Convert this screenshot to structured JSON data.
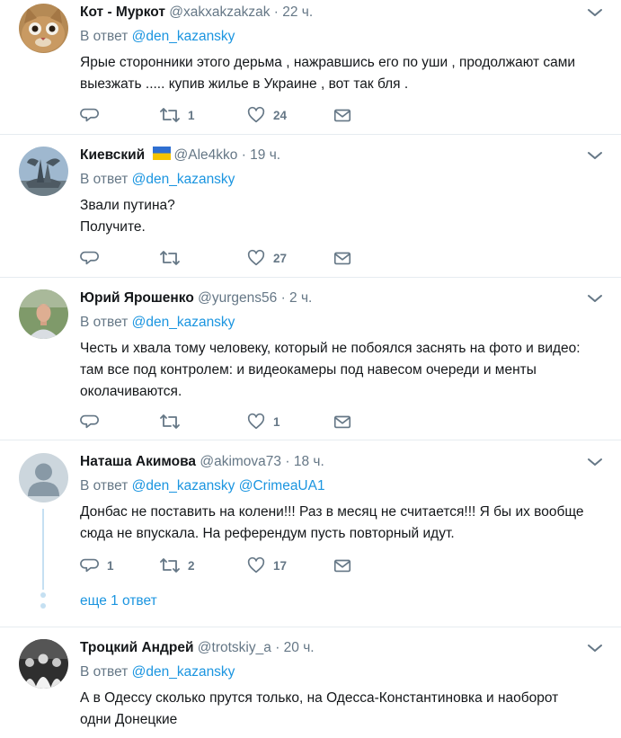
{
  "tweets": [
    {
      "name": "Кот - Муркот",
      "handle": "@xakxakzakzak",
      "time": "22 ч.",
      "reply_prefix": "В ответ",
      "reply_to": "@den_kazansky",
      "reply_to_2": "",
      "text": "Ярые сторонники этого дерьма , нажравшись его по уши  , продолжают сами выезжать ..... купив жилье в Украине , вот так бля .",
      "replies": "",
      "retweets": "1",
      "likes": "24",
      "avatar": "cat-photo"
    },
    {
      "name": "Киевский",
      "flag": "ukraine-flag",
      "handle": "@Ale4kko",
      "time": "19 ч.",
      "reply_prefix": "В ответ",
      "reply_to": "@den_kazansky",
      "reply_to_2": "",
      "text_lines": [
        "Звали путина?",
        "Получите."
      ],
      "replies": "",
      "retweets": "",
      "likes": "27",
      "avatar": "monument-photo"
    },
    {
      "name": "Юрий Ярошенко",
      "handle": "@yurgens56",
      "time": "2 ч.",
      "reply_prefix": "В ответ",
      "reply_to": "@den_kazansky",
      "reply_to_2": "",
      "text": "Честь и хвала тому человеку, который не побоялся заснять на фото и видео: там все под контролем: и видеокамеры под навесом очереди и менты околачиваются.",
      "replies": "",
      "retweets": "",
      "likes": "1",
      "avatar": "man-photo"
    },
    {
      "name": "Наташа Акимова",
      "handle": "@akimova73",
      "time": "18 ч.",
      "reply_prefix": "В ответ",
      "reply_to": "@den_kazansky",
      "reply_to_2": "@CrimeaUA1",
      "text": "Донбас не поставить на колени!!!  Раз в месяц не считается!!! Я бы их вообще сюда не впускала. На референдум пусть повторный идут.",
      "replies": "1",
      "retweets": "2",
      "likes": "17",
      "more_replies": "еще 1 ответ",
      "avatar": "default-profile"
    },
    {
      "name": "Троцкий Андрей",
      "handle": "@trotskiy_a",
      "time": "20 ч.",
      "reply_prefix": "В ответ",
      "reply_to": "@den_kazansky",
      "reply_to_2": "",
      "text": "А в Одессу сколько прутся только, на Одесса-Константиновка и наоборот одни Донецкие",
      "avatar": "group-photo"
    }
  ],
  "colors": {
    "link": "#1b95e0",
    "secondary": "#657786",
    "primary": "#14171a",
    "divider": "#e6ecf0",
    "thread": "#c5e0f2"
  },
  "icons": [
    "reply-icon",
    "retweet-icon",
    "like-icon",
    "message-icon",
    "chevron-down-icon"
  ]
}
